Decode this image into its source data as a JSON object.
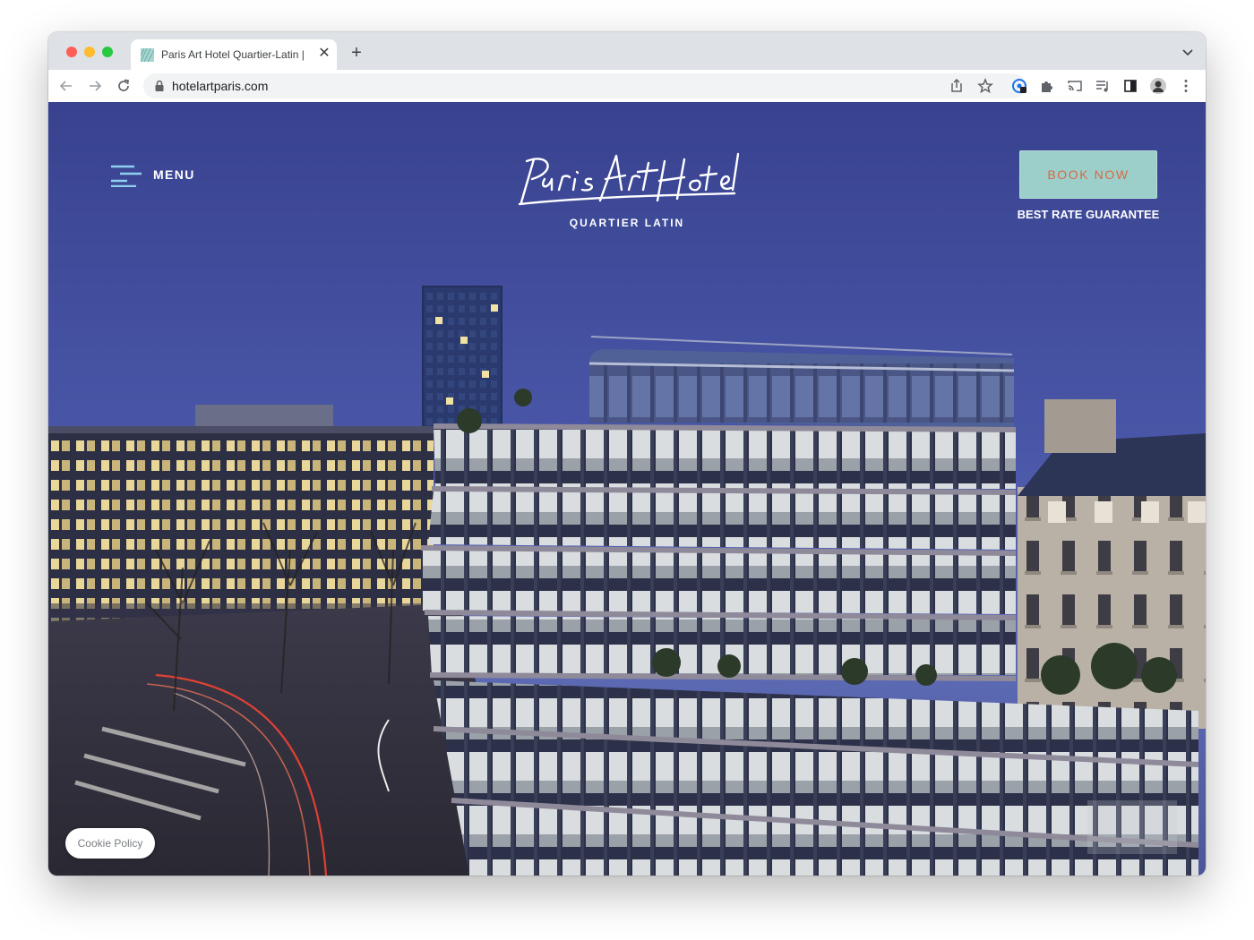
{
  "browser": {
    "tab": {
      "title": "Paris Art Hotel Quartier-Latin |",
      "favicon": "hotel-favicon-icon",
      "close_icon": "close-icon"
    },
    "new_tab_icon": "plus-icon",
    "tab_search_icon": "chevron-down-icon",
    "nav": {
      "back_icon": "arrow-left-icon",
      "forward_icon": "arrow-right-icon",
      "reload_icon": "reload-icon"
    },
    "address_bar": {
      "url": "hotelartparis.com",
      "lock_icon": "lock-icon",
      "share_icon": "share-icon",
      "bookmark_icon": "star-icon"
    },
    "extensions": [
      "extension-badge-icon",
      "puzzle-icon",
      "cast-icon",
      "media-queue-icon",
      "sidebar-icon",
      "profile-avatar",
      "kebab-menu-icon"
    ]
  },
  "page": {
    "menu": {
      "label": "MENU",
      "icon": "hamburger-icon"
    },
    "logo": {
      "name": "Paris Art Hotel",
      "subtitle": "QUARTIER LATIN"
    },
    "cta": {
      "book_label": "BOOK NOW",
      "guarantee": "BEST RATE GUARANTEE"
    },
    "cookie_label": "Cookie Policy",
    "hero_image": "paris-dusk-glass-office-building-photo"
  },
  "colors": {
    "sky_top": "#37428f",
    "sky_bottom": "#5a68b5",
    "book_button_bg": "#9dcfca",
    "book_button_text": "#d46a45",
    "chrome_bg": "#dee1e6"
  }
}
